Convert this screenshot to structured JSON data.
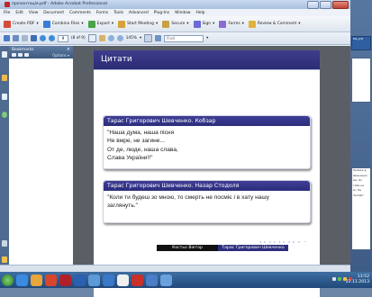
{
  "window": {
    "title": "презентація.pdf - Adobe Acrobat Professional"
  },
  "menu": [
    "File",
    "Edit",
    "View",
    "Document",
    "Comments",
    "Forms",
    "Tools",
    "Advanced",
    "Plug-Ins",
    "Window",
    "Help"
  ],
  "toolbar1": [
    {
      "label": "Create PDF",
      "icon": "create-pdf-icon",
      "color": "#d64a3a"
    },
    {
      "label": "Combine Files",
      "icon": "combine-files-icon",
      "color": "#3a7bd6"
    },
    {
      "label": "Export",
      "icon": "export-icon",
      "color": "#4aa34a"
    },
    {
      "label": "Start Meeting",
      "icon": "meeting-icon",
      "color": "#d6a23a"
    },
    {
      "label": "Secure",
      "icon": "lock-icon",
      "color": "#c7a048"
    },
    {
      "label": "Sign",
      "icon": "pen-icon",
      "color": "#6b6bd6"
    },
    {
      "label": "Forms",
      "icon": "forms-icon",
      "color": "#8a6bd6"
    },
    {
      "label": "Review & Comment",
      "icon": "comment-icon",
      "color": "#e0b23a"
    }
  ],
  "toolbar2": {
    "page_value": "9",
    "page_of": "(8 of 9)",
    "zoom": "145%",
    "find_placeholder": "Find"
  },
  "bookmarks": {
    "title": "Bookmarks",
    "options": "Options"
  },
  "slide": {
    "title": "Цитати",
    "cards": [
      {
        "header": "Тарас Григорович Шевченко. Кобзар",
        "lines": [
          "\"Наша дума, наша пісня",
          "Не вмре, не загине...",
          "От де, люде, наша слава,",
          "Слава України!!\""
        ]
      },
      {
        "header": "Тарас Григорович Шевченко. Назар Стодоля",
        "lines": [
          "\"Коли ти будеш зо мною, то смерть не посміє і в хату нашу",
          "заглянуть.\""
        ]
      }
    ],
    "footer_left": "Костьо Віктор",
    "footer_right": "Тарас Григорович Шевченко"
  },
  "right_strip": {
    "label_top": "file_pdf",
    "snippets": [
      "Правка д",
      "Шевченко",
      "ми. Ко",
      "тебе на",
      "мі. Не",
      "Заповіт"
    ]
  },
  "taskbar": {
    "time": "13:52",
    "date": "22.11.2013"
  },
  "colors": {
    "slide_title_bar": "#2b2b74",
    "card_header": "#2c2d7c"
  }
}
